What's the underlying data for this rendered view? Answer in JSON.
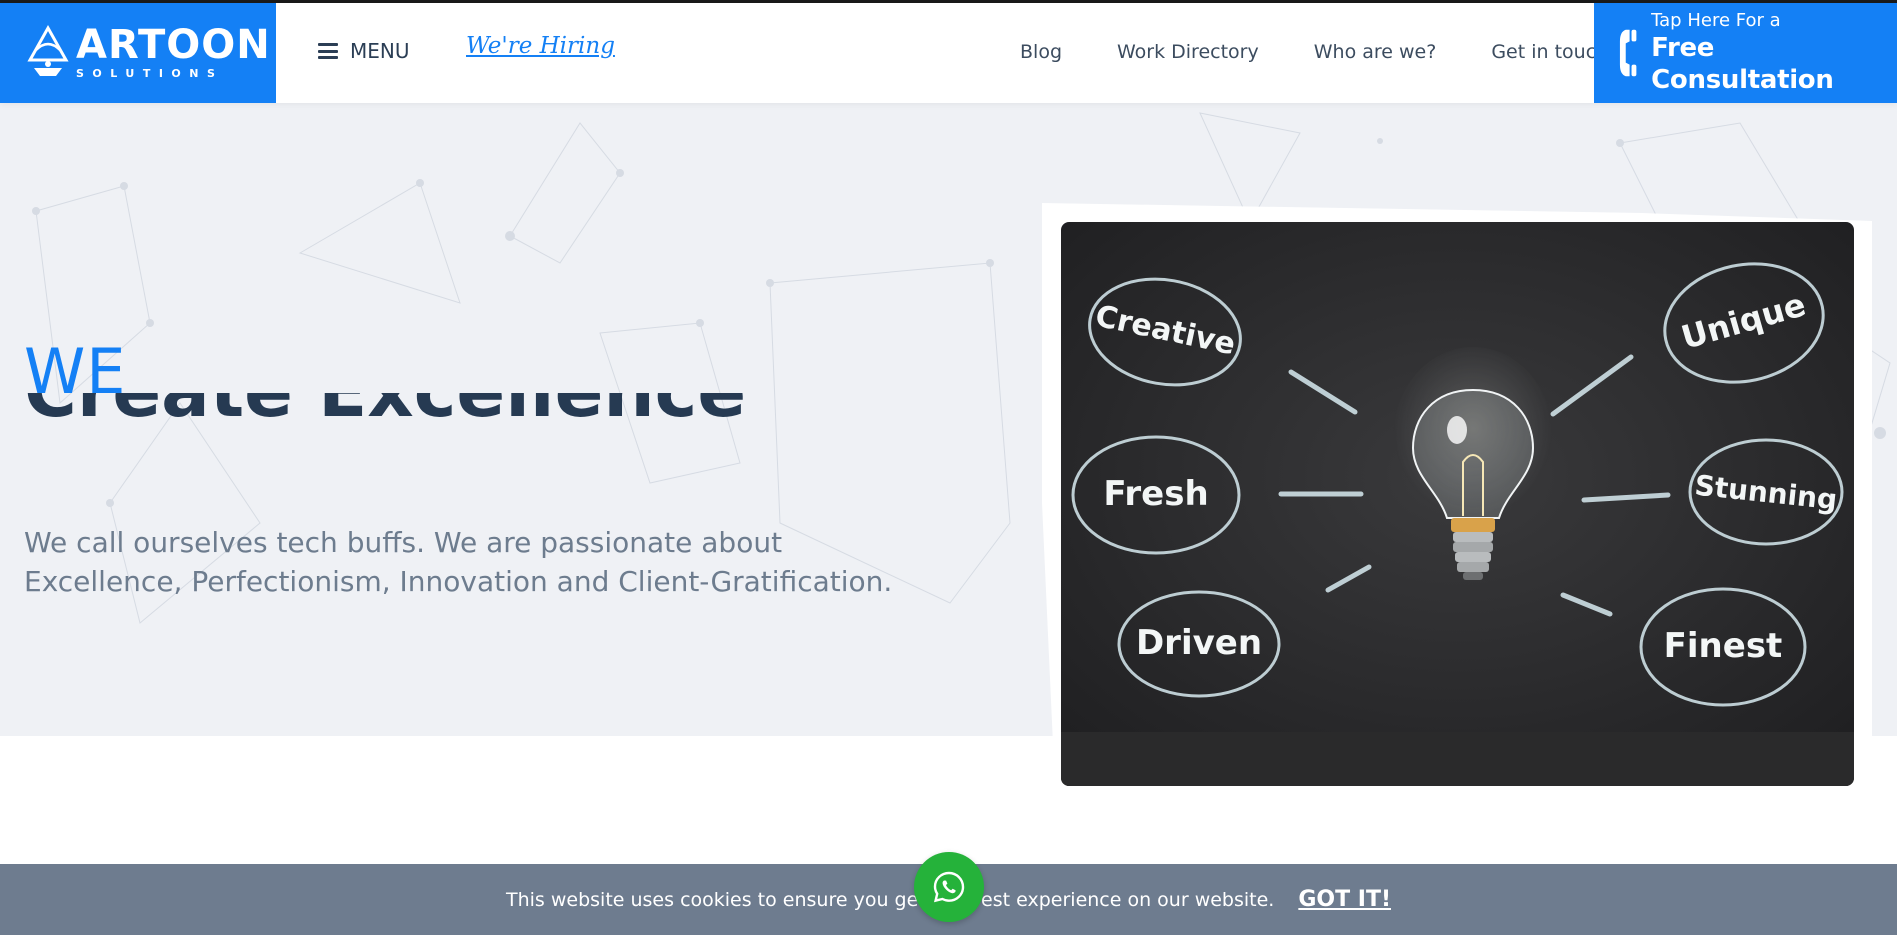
{
  "header": {
    "logo": {
      "name": "ARTOON",
      "sub": "SOLUTIONS"
    },
    "menu_label": "MENU",
    "hiring_label": "We're Hiring",
    "nav": [
      "Blog",
      "Work Directory",
      "Who are we?",
      "Get in touch"
    ],
    "consult": {
      "small": "Tap Here For a",
      "big": "Free Consultation"
    }
  },
  "hero": {
    "we": "WE",
    "headline": "Create Excellence",
    "lead": "We call ourselves tech buffs. We are passionate about Excellence, Perfectionism, Innovation and Client-Gratification."
  },
  "board_words": [
    "Creative",
    "Fresh",
    "Driven",
    "Unique",
    "Stunning",
    "Finest"
  ],
  "cookie": {
    "text": "This website uses cookies to ensure you get the best experience on our website.",
    "button": "GOT IT!"
  },
  "colors": {
    "brand": "#1480f5",
    "dark": "#263a52",
    "cookie_bg": "#6e7c8f",
    "whatsapp": "#25b23a"
  },
  "icons": {
    "menu": "hamburger-icon",
    "phone": "phone-icon",
    "whatsapp": "whatsapp-icon"
  }
}
